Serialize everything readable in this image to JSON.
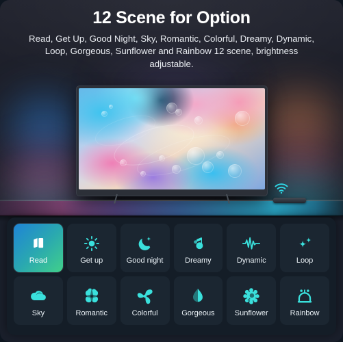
{
  "header": {
    "title": "12 Scene for Option",
    "subtitle": "Read, Get Up, Good Night, Sky, Romantic, Colorful, Dreamy, Dynamic, Loop, Gorgeous, Sunflower and Rainbow 12 scene, brightness adjustable."
  },
  "device": {
    "wifi_icon": "wifi-icon",
    "soundbar": "soundbar-device",
    "tv_screen": "tv-screen-abstract-fluid-art"
  },
  "colors": {
    "accent_cyan": "#3ae0dc",
    "active_gradient_start": "#1f84d6",
    "active_gradient_mid": "#2aa8b0",
    "active_gradient_end": "#41d08a",
    "panel_bg": "#141d27",
    "cell_bg": "#1b2631",
    "text": "#eaf1f6"
  },
  "scenes": [
    {
      "label": "Read",
      "icon": "book-icon",
      "active": true
    },
    {
      "label": "Get up",
      "icon": "sun-icon",
      "active": false
    },
    {
      "label": "Good night",
      "icon": "moon-star-icon",
      "active": false
    },
    {
      "label": "Dreamy",
      "icon": "music-note-icon",
      "active": false
    },
    {
      "label": "Dynamic",
      "icon": "pulse-wave-icon",
      "active": false
    },
    {
      "label": "Loop",
      "icon": "sparkles-icon",
      "active": false
    },
    {
      "label": "Sky",
      "icon": "cloud-icon",
      "active": false
    },
    {
      "label": "Romantic",
      "icon": "clover-icon",
      "active": false
    },
    {
      "label": "Colorful",
      "icon": "pinwheel-icon",
      "active": false
    },
    {
      "label": "Gorgeous",
      "icon": "water-drop-icon",
      "active": false
    },
    {
      "label": "Sunflower",
      "icon": "flower-gear-icon",
      "active": false
    },
    {
      "label": "Rainbow",
      "icon": "arch-lamp-icon",
      "active": false
    }
  ]
}
